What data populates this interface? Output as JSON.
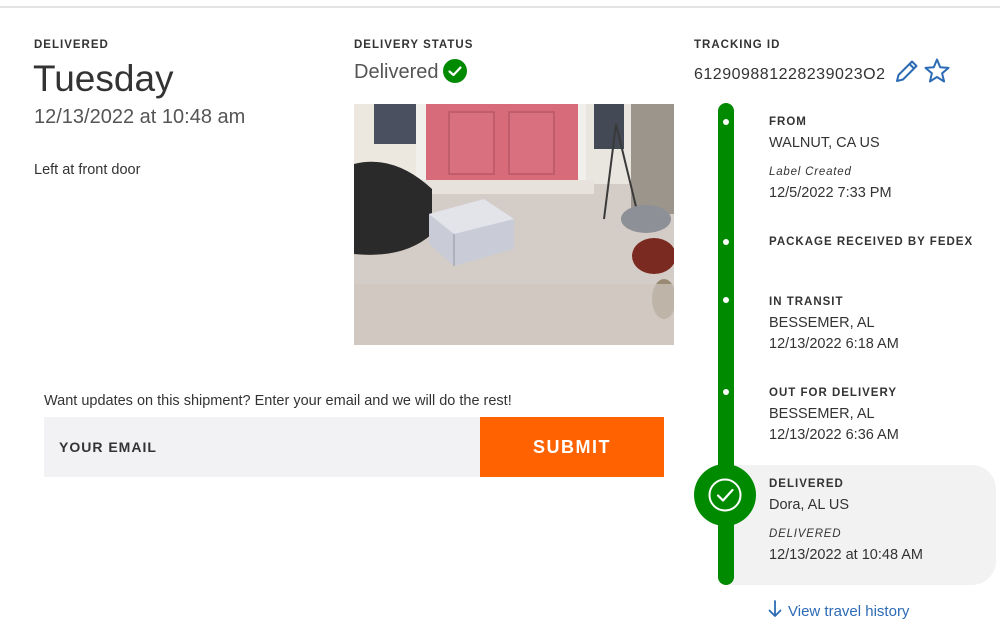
{
  "summary": {
    "delivered_heading": "DELIVERED",
    "day": "Tuesday",
    "datetime": "12/13/2022 at 10:48 am",
    "location_note": "Left at front door"
  },
  "status": {
    "heading": "DELIVERY STATUS",
    "value": "Delivered",
    "icon": "check-circle-icon",
    "color": "#008a00"
  },
  "tracking": {
    "heading": "TRACKING ID",
    "number": "612909881228239023O2"
  },
  "updates": {
    "prompt": "Want updates on this shipment? Enter your email and we will do the rest!",
    "email_placeholder": "YOUR EMAIL",
    "submit_label": "SUBMIT",
    "submit_color": "#ff6200"
  },
  "timeline": {
    "events": [
      {
        "title": "FROM",
        "line1": "WALNUT, CA US",
        "italic": "Label Created",
        "line2": "12/5/2022 7:33 PM"
      },
      {
        "title": "PACKAGE RECEIVED BY FEDEX"
      },
      {
        "title": "IN TRANSIT",
        "line1": "BESSEMER, AL",
        "line2": "12/13/2022 6:18 AM"
      },
      {
        "title": "OUT FOR DELIVERY",
        "line1": "BESSEMER, AL",
        "line2": "12/13/2022 6:36 AM"
      },
      {
        "title": "DELIVERED",
        "line1": "Dora, AL US",
        "italic": "DELIVERED",
        "line2": "12/13/2022 at 10:48 AM"
      }
    ],
    "history_link": "View travel history"
  }
}
